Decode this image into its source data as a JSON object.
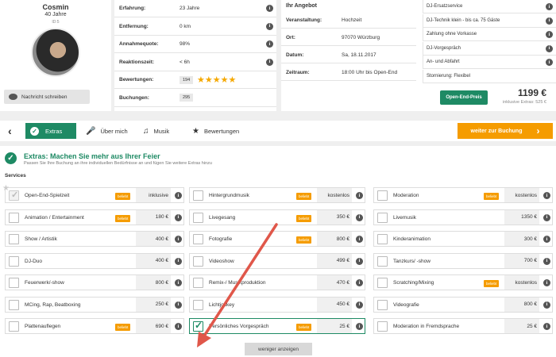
{
  "profile": {
    "name": "Cosmin",
    "age": "40 Jahre",
    "id": "ID:5",
    "message_btn": "Nachricht schreiben"
  },
  "stats": [
    {
      "label": "Erfahrung:",
      "value": "23 Jahre"
    },
    {
      "label": "Entfernung:",
      "value": "0 km"
    },
    {
      "label": "Annahmequote:",
      "value": "98%"
    },
    {
      "label": "Reaktionszeit:",
      "value": "< 6h"
    },
    {
      "label": "Bewertungen:",
      "value": "194",
      "stars": 5
    },
    {
      "label": "Buchungen:",
      "value": "295"
    }
  ],
  "offer": {
    "title": "Ihr Angebot",
    "rows": [
      {
        "label": "Veranstaltung:",
        "value": "Hochzeit"
      },
      {
        "label": "Ort:",
        "value": "97070 Würzburg"
      },
      {
        "label": "Datum:",
        "value": "Sa, 18.11.2017"
      },
      {
        "label": "Zeitraum:",
        "value": "18:00 Uhr bis Open-End"
      }
    ],
    "features": [
      "DJ-Ersatzservice",
      "DJ-Technik klein - bis ca. 75 Gäste",
      "Zahlung ohne Vorkasse",
      "DJ-Vorgespräch",
      "An- und Abfahrt",
      "Stornierung: Flexibel"
    ],
    "price_btn": "Open-End-Preis",
    "price": "1199 €",
    "price_sub": "inklusive Extras: 525 €"
  },
  "tabs": [
    {
      "label": "Extras",
      "icon": "check-circle-icon"
    },
    {
      "label": "Über mich",
      "icon": "microphone-icon"
    },
    {
      "label": "Musik",
      "icon": "music-note-icon"
    },
    {
      "label": "Bewertungen",
      "icon": "star-icon"
    }
  ],
  "book_btn": "weiter zur Buchung",
  "extras": {
    "title": "Extras: Machen Sie mehr aus Ihrer Feier",
    "subtitle": "Passen Sie Ihre Buchung an ihre individuellen Bedürfnisse an und fügen Sie weitere Extras hinzu",
    "section": "Services",
    "badge_text": "beliebt",
    "columns": [
      [
        {
          "name": "Open-End-Spielzeit",
          "price": "inklusive",
          "popular": true,
          "checked": true,
          "disabled": true
        },
        {
          "name": "Animation / Entertainment",
          "price": "180 €",
          "popular": true
        },
        {
          "name": "Show / Artistik",
          "price": "400 €"
        },
        {
          "name": "DJ-Duo",
          "price": "400 €"
        },
        {
          "name": "Feuerwerk/-show",
          "price": "800 €"
        },
        {
          "name": "MCing, Rap, Beatboxing",
          "price": "250 €"
        },
        {
          "name": "Plattenauflegen",
          "price": "690 €",
          "popular": true
        }
      ],
      [
        {
          "name": "Hintergrundmusik",
          "price": "kostenlos",
          "popular": true
        },
        {
          "name": "Livegesang",
          "price": "350 €",
          "popular": true
        },
        {
          "name": "Fotografie",
          "price": "800 €",
          "popular": true
        },
        {
          "name": "Videoshow",
          "price": "499 €"
        },
        {
          "name": "Remix-/ Musikproduktion",
          "price": "470 €"
        },
        {
          "name": "Lichtjockey",
          "price": "450 €"
        },
        {
          "name": "Persönliches Vorgespräch",
          "price": "25 €",
          "popular": true,
          "checked": true,
          "selected": true
        }
      ],
      [
        {
          "name": "Moderation",
          "price": "kostenlos",
          "popular": true
        },
        {
          "name": "Livemusik",
          "price": "1350 €"
        },
        {
          "name": "Kinderanimation",
          "price": "300 €"
        },
        {
          "name": "Tanzkurs/ -show",
          "price": "700 €"
        },
        {
          "name": "Scratching/Mixing",
          "price": "kostenlos",
          "popular": true
        },
        {
          "name": "Videografie",
          "price": "800 €"
        },
        {
          "name": "Moderation in Fremdsprache",
          "price": "25 €"
        }
      ]
    ],
    "less_btn": "weniger anzeigen"
  },
  "colors": {
    "green": "#1e8a64",
    "orange": "#f59c00",
    "arrow": "#e0574a"
  }
}
